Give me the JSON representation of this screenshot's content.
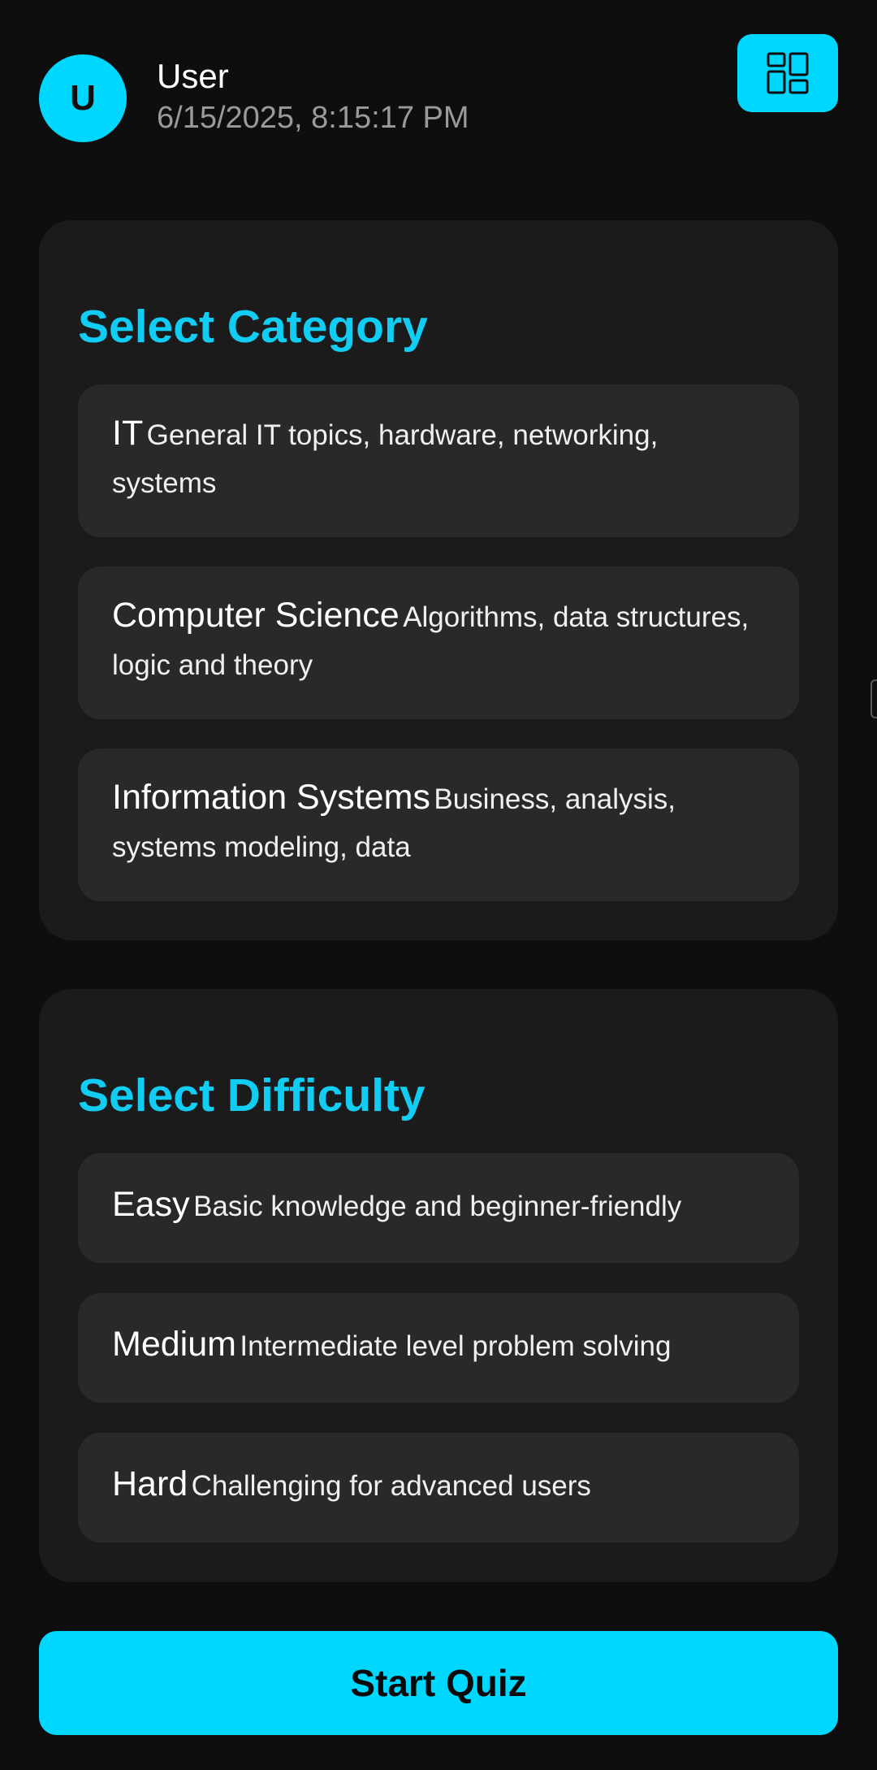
{
  "header": {
    "avatar_letter": "U",
    "user_name": "User",
    "timestamp": "6/15/2025, 8:15:17 PM",
    "menu_icon": "dashboard-grid-icon"
  },
  "category": {
    "title": "Select Category",
    "options": [
      {
        "name": "IT",
        "description": "General IT topics, hardware, networking, systems"
      },
      {
        "name": "Computer Science",
        "description": "Algorithms, data structures, logic and theory"
      },
      {
        "name": "Information Systems",
        "description": "Business, analysis, systems modeling, data"
      }
    ]
  },
  "difficulty": {
    "title": "Select Difficulty",
    "options": [
      {
        "name": "Easy",
        "description": "Basic knowledge and beginner-friendly"
      },
      {
        "name": "Medium",
        "description": "Intermediate level problem solving"
      },
      {
        "name": "Hard",
        "description": "Challenging for advanced users"
      }
    ]
  },
  "start_button_label": "Start Quiz",
  "colors": {
    "accent": "#00d7ff",
    "background": "#0e0e0e",
    "card": "#1b1b1b",
    "option": "#292929"
  }
}
